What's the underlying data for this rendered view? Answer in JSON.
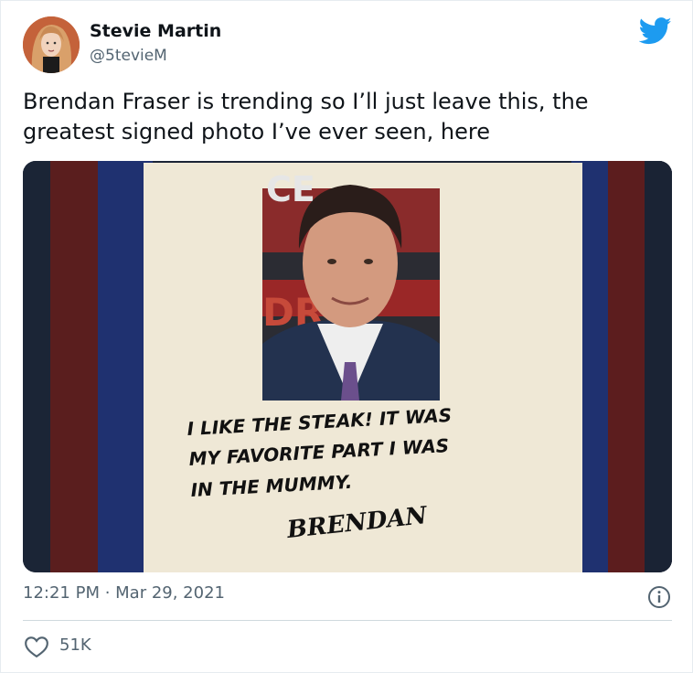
{
  "author": {
    "display_name": "Stevie Martin",
    "handle": "@5tevieM"
  },
  "tweet": {
    "text": "Brendan Fraser is trending so I’ll just leave this, the greatest signed photo I’ve ever seen, here",
    "timestamp": "12:21 PM · Mar 29, 2021",
    "likes": "51K"
  },
  "media": {
    "backdrop_letters_top": "CE",
    "backdrop_letters_bottom": "DR",
    "inscription": [
      "I LIKE THE STEAK! IT WAS",
      "MY FAVORITE PART I WAS",
      "IN THE MUMMY."
    ],
    "signature": "BRENDAN"
  },
  "icons": {
    "brand": "twitter-bird-icon",
    "info": "info-icon",
    "like": "heart-icon"
  },
  "colors": {
    "twitter_blue": "#1d9bf0",
    "text_primary": "#0f1419",
    "text_secondary": "#536471",
    "divider": "#cfd9de"
  }
}
